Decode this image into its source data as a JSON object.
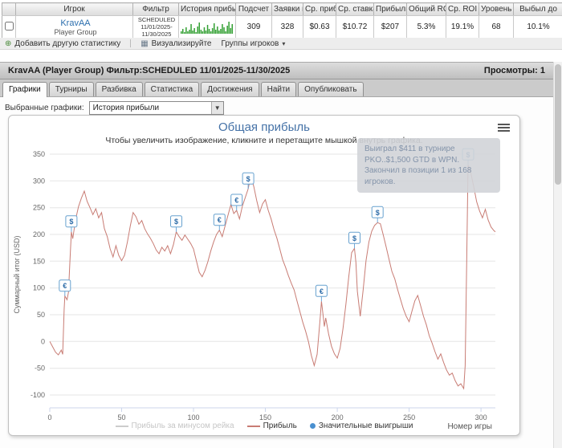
{
  "table": {
    "headers": [
      "Игрок",
      "Фильтр",
      "История прибыл",
      "Подсчет",
      "Заявки н",
      "Ср. приб",
      "Ср. ставка",
      "Прибыль",
      "Общий ROI",
      "Ср. ROI",
      "Уровень",
      "Выбыл до"
    ],
    "row": {
      "player_name": "KravAA",
      "player_group": "Player Group",
      "filter_lines": [
        "SCHEDULED",
        "11/01/2025-",
        "11/30/2025"
      ],
      "sparkline": [
        3,
        6,
        2,
        8,
        3,
        5,
        12,
        4,
        7,
        2,
        9,
        14,
        5,
        3,
        8,
        4,
        11,
        6,
        3,
        7,
        13,
        5,
        9,
        4,
        6,
        12,
        8,
        3,
        10,
        15,
        7,
        12
      ],
      "count": "309",
      "entries": "328",
      "avg_profit": "$0.63",
      "avg_stake": "$10.72",
      "profit": "$207",
      "total_roi": "5.3%",
      "avg_roi": "19.1%",
      "level": "68",
      "busted_pct": "10.1%"
    }
  },
  "toolbar": {
    "add_stat": "Добавить другую статистику",
    "visualize": "Визуализируйте",
    "groups": "Группы игроков"
  },
  "panel": {
    "title": "KravAA (Player Group) Фильтр:SCHEDULED 11/01/2025-11/30/2025",
    "views": "Просмотры: 1",
    "tabs": [
      "Графики",
      "Турниры",
      "Разбивка",
      "Статистика",
      "Достижения",
      "Найти",
      "Опубликовать"
    ],
    "charts_label": "Выбранные графики:",
    "chart_select": "История прибыли"
  },
  "chart_data": {
    "type": "line",
    "title": "Общая прибыль",
    "subtitle": "Чтобы увеличить изображение, кликните и перетащите мышкой внутрь графика.",
    "ylabel": "Суммарный итог (USD)",
    "xlabel": "Номер игры",
    "xlim": [
      0,
      310
    ],
    "ylim": [
      -100,
      350
    ],
    "xticks": [
      0,
      50,
      100,
      150,
      200,
      250,
      300
    ],
    "yticks": [
      350,
      300,
      250,
      200,
      150,
      100,
      50,
      0,
      -50,
      -100
    ],
    "grid": "horizontal-only",
    "legend_position": "bottom-center",
    "series": [
      {
        "name": "Прибыль за минусом рейка",
        "color": "#cccccc",
        "visible": false,
        "points": []
      },
      {
        "name": "Прибыль",
        "color": "#c87c74",
        "visible": true,
        "points": [
          [
            0,
            0
          ],
          [
            2,
            -10
          ],
          [
            4,
            -20
          ],
          [
            6,
            -25
          ],
          [
            8,
            -16
          ],
          [
            9,
            -24
          ],
          [
            10,
            60
          ],
          [
            10.5,
            85
          ],
          [
            12,
            78
          ],
          [
            13,
            92
          ],
          [
            14,
            150
          ],
          [
            15,
            205
          ],
          [
            16,
            192
          ],
          [
            18,
            228
          ],
          [
            20,
            252
          ],
          [
            22,
            268
          ],
          [
            24,
            281
          ],
          [
            26,
            262
          ],
          [
            28,
            250
          ],
          [
            30,
            237
          ],
          [
            32,
            248
          ],
          [
            34,
            231
          ],
          [
            36,
            241
          ],
          [
            38,
            211
          ],
          [
            40,
            196
          ],
          [
            42,
            173
          ],
          [
            44,
            158
          ],
          [
            46,
            179
          ],
          [
            48,
            161
          ],
          [
            50,
            151
          ],
          [
            52,
            161
          ],
          [
            54,
            186
          ],
          [
            56,
            216
          ],
          [
            58,
            241
          ],
          [
            60,
            233
          ],
          [
            62,
            219
          ],
          [
            64,
            226
          ],
          [
            66,
            211
          ],
          [
            68,
            201
          ],
          [
            70,
            193
          ],
          [
            72,
            183
          ],
          [
            74,
            171
          ],
          [
            76,
            164
          ],
          [
            78,
            176
          ],
          [
            80,
            169
          ],
          [
            82,
            179
          ],
          [
            84,
            164
          ],
          [
            86,
            181
          ],
          [
            88,
            205
          ],
          [
            90,
            196
          ],
          [
            92,
            189
          ],
          [
            94,
            199
          ],
          [
            96,
            191
          ],
          [
            98,
            183
          ],
          [
            100,
            173
          ],
          [
            102,
            151
          ],
          [
            104,
            129
          ],
          [
            106,
            121
          ],
          [
            108,
            133
          ],
          [
            110,
            149
          ],
          [
            112,
            169
          ],
          [
            114,
            186
          ],
          [
            116,
            200
          ],
          [
            118,
            208
          ],
          [
            120,
            196
          ],
          [
            122,
            216
          ],
          [
            124,
            236
          ],
          [
            126,
            256
          ],
          [
            128,
            239
          ],
          [
            130,
            245
          ],
          [
            132,
            229
          ],
          [
            134,
            253
          ],
          [
            136,
            269
          ],
          [
            138,
            285
          ],
          [
            140,
            310
          ],
          [
            142,
            289
          ],
          [
            144,
            263
          ],
          [
            146,
            241
          ],
          [
            148,
            257
          ],
          [
            150,
            265
          ],
          [
            152,
            245
          ],
          [
            154,
            229
          ],
          [
            156,
            209
          ],
          [
            158,
            193
          ],
          [
            160,
            173
          ],
          [
            162,
            153
          ],
          [
            164,
            139
          ],
          [
            166,
            123
          ],
          [
            168,
            109
          ],
          [
            170,
            96
          ],
          [
            172,
            76
          ],
          [
            174,
            56
          ],
          [
            176,
            36
          ],
          [
            178,
            19
          ],
          [
            180,
            -1
          ],
          [
            182,
            -26
          ],
          [
            184,
            -45
          ],
          [
            186,
            -24
          ],
          [
            188,
            40
          ],
          [
            189,
            75
          ],
          [
            190,
            52
          ],
          [
            191,
            28
          ],
          [
            192,
            44
          ],
          [
            194,
            14
          ],
          [
            196,
            -9
          ],
          [
            198,
            -23
          ],
          [
            200,
            -31
          ],
          [
            202,
            -13
          ],
          [
            204,
            24
          ],
          [
            206,
            69
          ],
          [
            208,
            121
          ],
          [
            210,
            166
          ],
          [
            212,
            174
          ],
          [
            213,
            148
          ],
          [
            214,
            94
          ],
          [
            216,
            47
          ],
          [
            218,
            96
          ],
          [
            220,
            151
          ],
          [
            222,
            186
          ],
          [
            224,
            206
          ],
          [
            226,
            217
          ],
          [
            228,
            222
          ],
          [
            230,
            220
          ],
          [
            232,
            199
          ],
          [
            234,
            177
          ],
          [
            236,
            154
          ],
          [
            238,
            131
          ],
          [
            240,
            117
          ],
          [
            242,
            97
          ],
          [
            244,
            79
          ],
          [
            246,
            61
          ],
          [
            248,
            47
          ],
          [
            250,
            37
          ],
          [
            252,
            57
          ],
          [
            254,
            76
          ],
          [
            256,
            86
          ],
          [
            258,
            67
          ],
          [
            260,
            47
          ],
          [
            262,
            31
          ],
          [
            264,
            11
          ],
          [
            266,
            -3
          ],
          [
            268,
            -19
          ],
          [
            270,
            -33
          ],
          [
            272,
            -23
          ],
          [
            274,
            -39
          ],
          [
            276,
            -53
          ],
          [
            278,
            -63
          ],
          [
            280,
            -59
          ],
          [
            282,
            -73
          ],
          [
            284,
            -83
          ],
          [
            286,
            -79
          ],
          [
            288,
            -88
          ],
          [
            289,
            -45
          ],
          [
            290,
            140
          ],
          [
            291,
            330
          ],
          [
            293,
            314
          ],
          [
            295,
            289
          ],
          [
            297,
            261
          ],
          [
            299,
            244
          ],
          [
            301,
            231
          ],
          [
            303,
            247
          ],
          [
            305,
            227
          ],
          [
            307,
            214
          ],
          [
            309,
            207
          ],
          [
            310,
            205
          ]
        ]
      }
    ],
    "markers_name": "Значительные выигрыши",
    "marker_color": "#4a90d0",
    "markers": [
      {
        "x": 10.5,
        "y": 85,
        "label": "€"
      },
      {
        "x": 15,
        "y": 205,
        "label": "$"
      },
      {
        "x": 88,
        "y": 205,
        "label": "$"
      },
      {
        "x": 118,
        "y": 208,
        "label": "€"
      },
      {
        "x": 130,
        "y": 245,
        "label": "€"
      },
      {
        "x": 138,
        "y": 285,
        "label": "$"
      },
      {
        "x": 189,
        "y": 75,
        "label": "€"
      },
      {
        "x": 212,
        "y": 174,
        "label": "$"
      },
      {
        "x": 228,
        "y": 222,
        "label": "$"
      },
      {
        "x": 291,
        "y": 330,
        "label": "$"
      }
    ],
    "tooltip_text": "Выиграл $411 в турнире PKO..$1,500 GTD в WPN. Закончил в позиции 1 из 168 игроков."
  }
}
